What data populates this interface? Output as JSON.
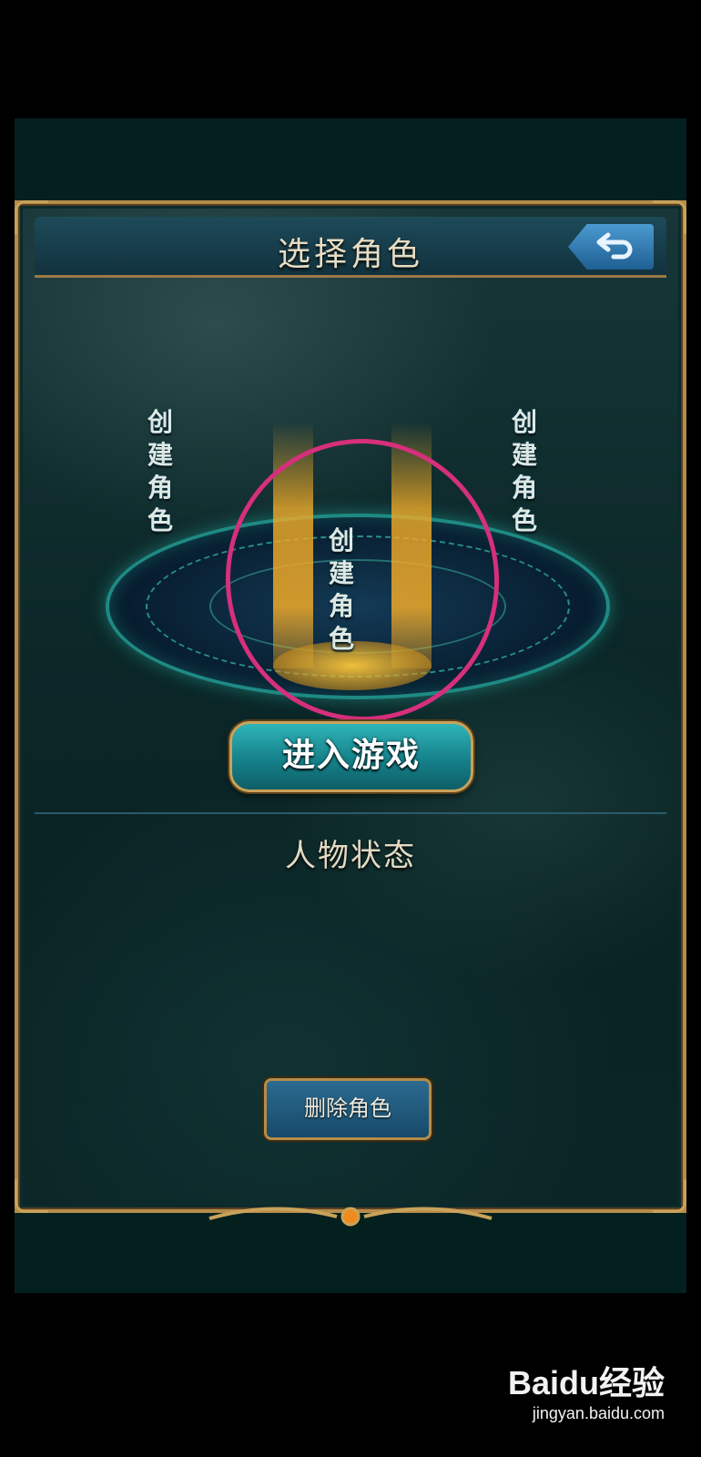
{
  "header": {
    "title": "选择角色",
    "back_icon": "return-arrow-icon"
  },
  "character_slots": [
    {
      "label": "创建角色"
    },
    {
      "label": "创建角色"
    },
    {
      "label": "创建角色"
    }
  ],
  "enter_game_label": "进入游戏",
  "status_section": {
    "title": "人物状态"
  },
  "delete_role_label": "删除角色",
  "watermark": {
    "logo": "Baidu经验",
    "url": "jingyan.baidu.com"
  },
  "colors": {
    "accent_gold": "#b58c4a",
    "teal_button": "#15818a",
    "highlight": "#d62f7c"
  }
}
